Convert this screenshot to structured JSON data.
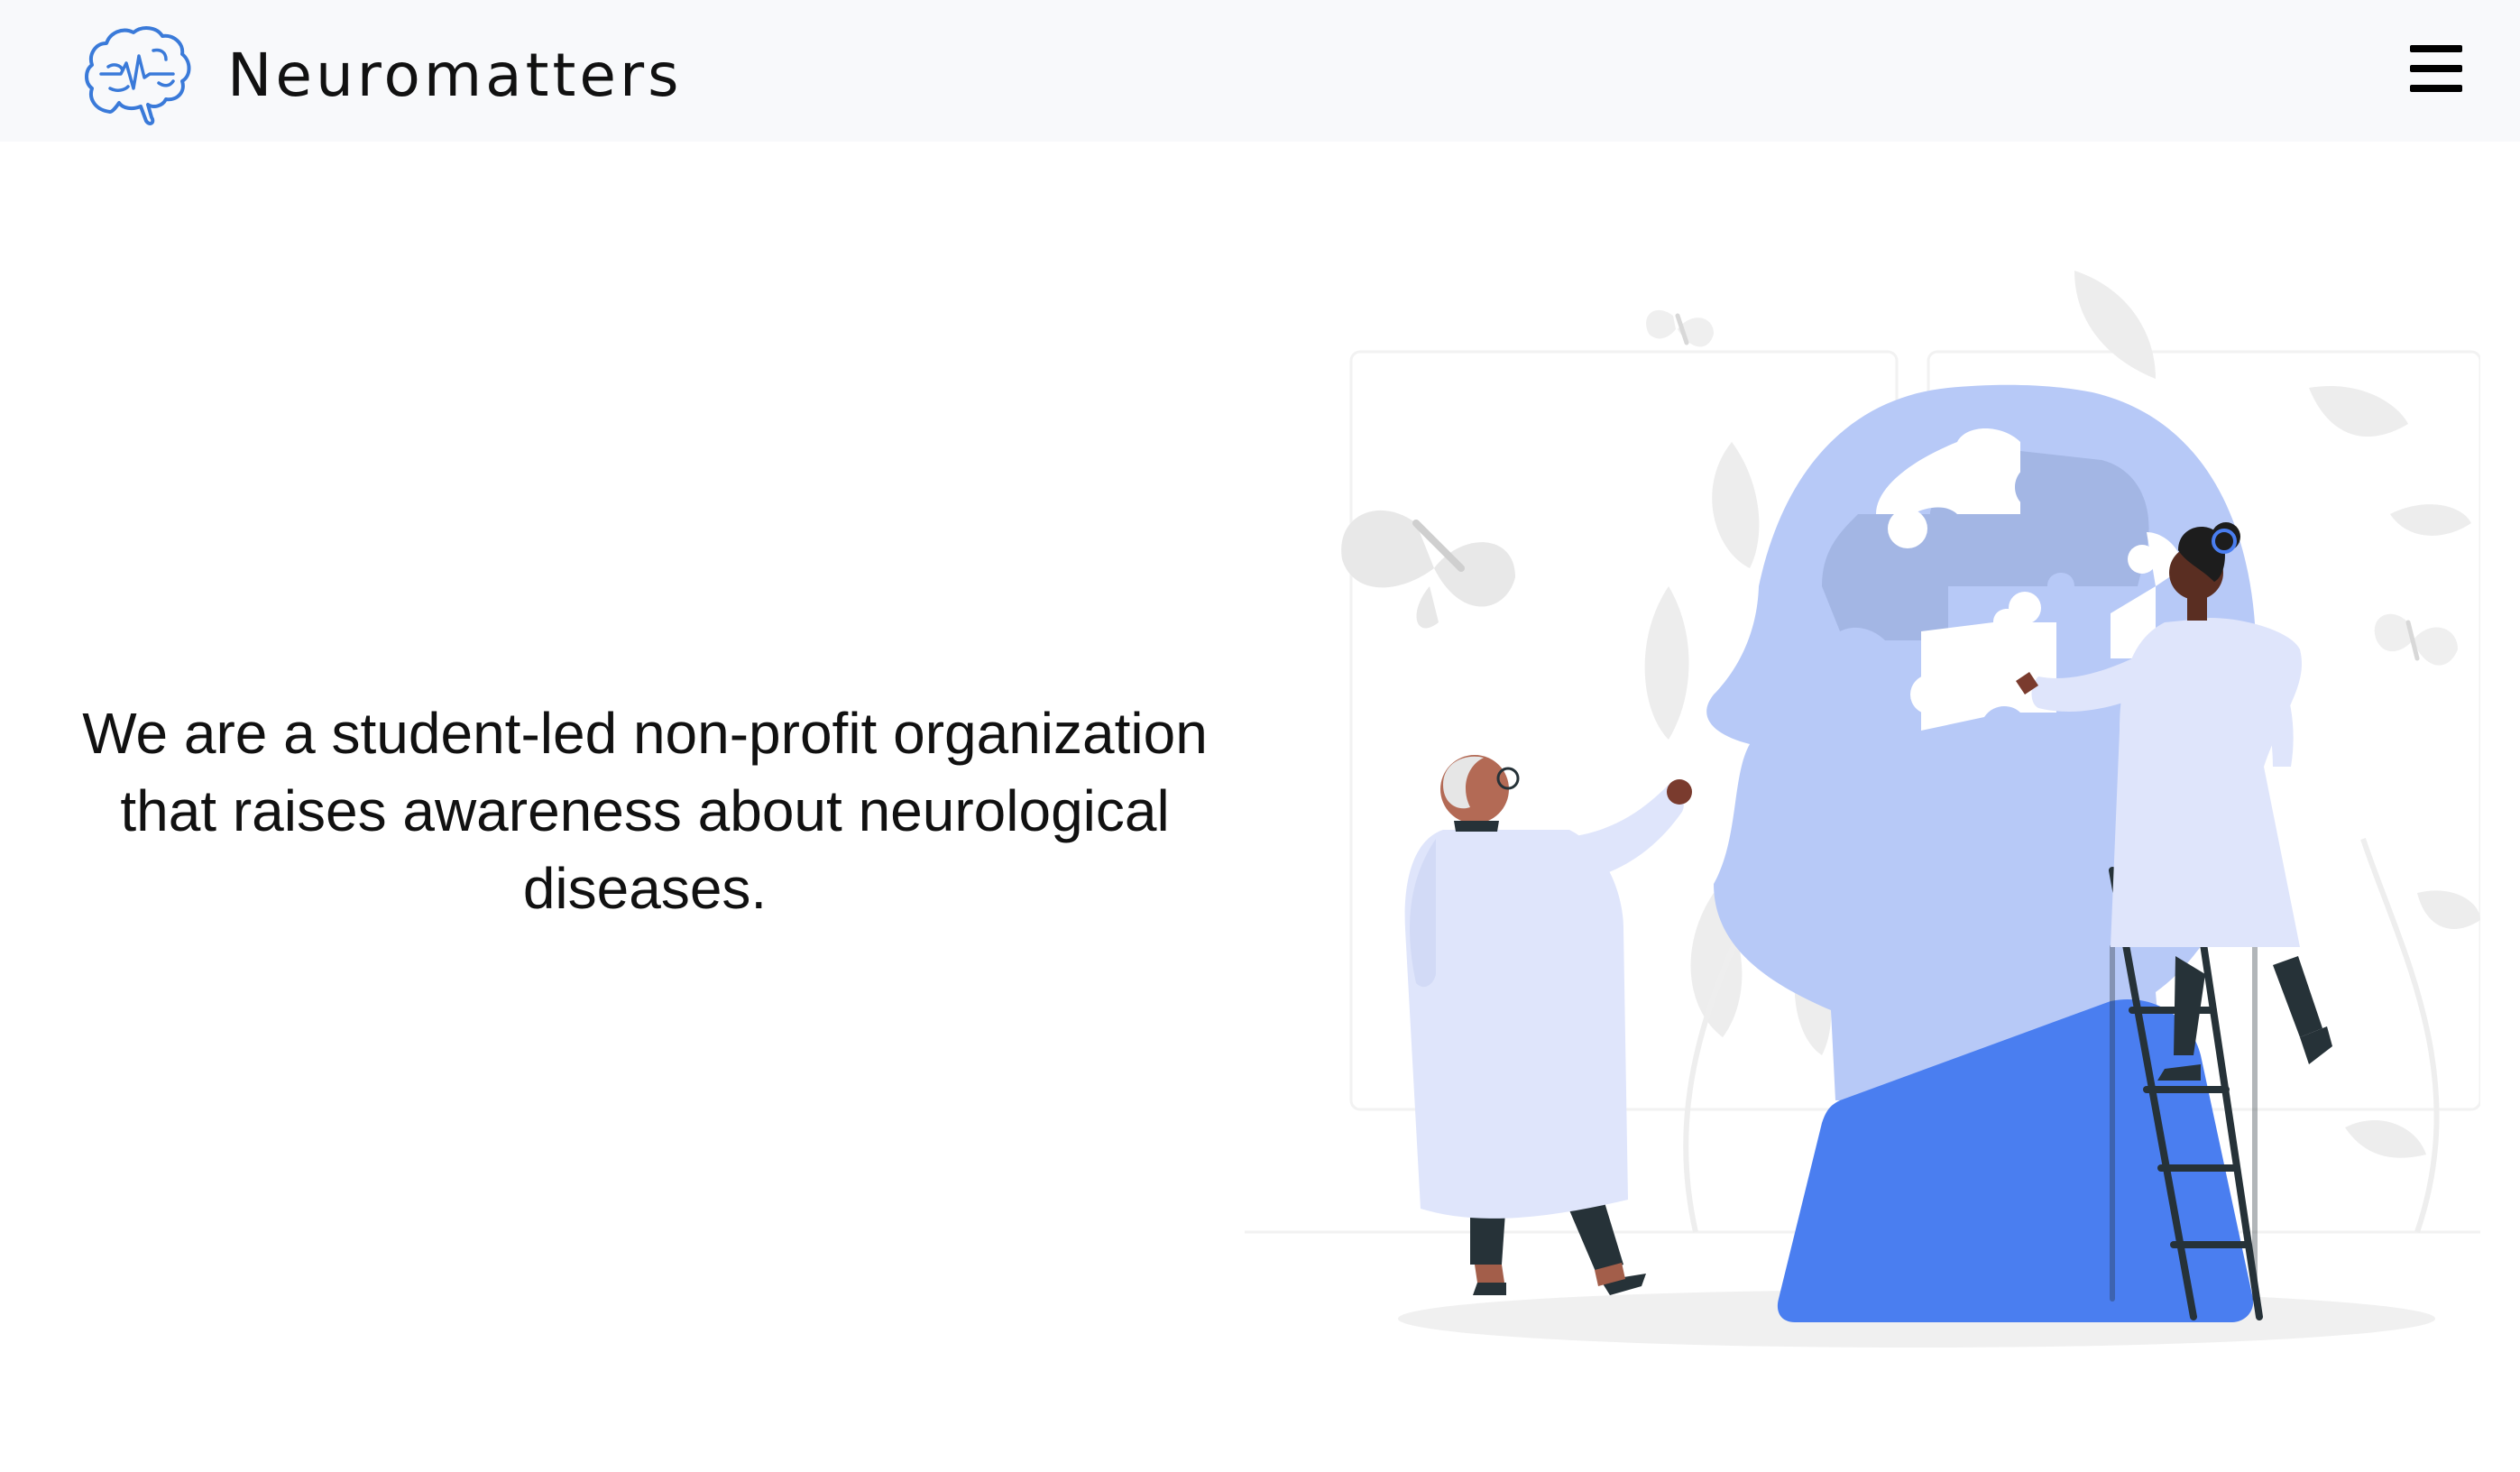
{
  "navbar": {
    "brand_name": "Neuromatters",
    "logo_icon": "brain-heartbeat-icon",
    "menu_icon": "hamburger-menu-icon"
  },
  "hero": {
    "tagline": "We are a student-led non-profit organization that raises awareness about neurological diseases."
  },
  "illustration": {
    "subject": "scientists-assembling-brain-puzzle-illustration"
  },
  "colors": {
    "navbar_bg": "#f8f9fb",
    "accent_blue": "#4a7ef0",
    "light_blue": "#b7c9f7",
    "puzzle_blue": "#a3b6e4",
    "text": "#111111"
  }
}
